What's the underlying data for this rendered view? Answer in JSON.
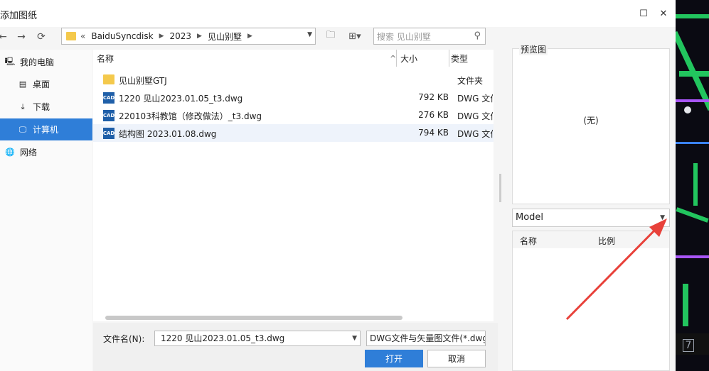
{
  "dialog": {
    "title": "添加图纸",
    "maximize_glyph": "☐",
    "close_glyph": "✕"
  },
  "nav": {
    "breadcrumb": [
      "BaiduSyncdisk",
      "2023",
      "见山别墅"
    ],
    "overflow": "«",
    "search_placeholder": "搜索 见山别墅"
  },
  "sidebar": {
    "items": [
      {
        "label": "我的电脑",
        "icon": "computer-icon"
      },
      {
        "label": "桌面",
        "icon": "desktop-icon"
      },
      {
        "label": "下载",
        "icon": "download-icon"
      },
      {
        "label": "计算机",
        "icon": "monitor-icon"
      },
      {
        "label": "网络",
        "icon": "globe-icon"
      }
    ]
  },
  "columns": {
    "name": "名称",
    "size": "大小",
    "type": "类型"
  },
  "files": [
    {
      "name": "见山别墅GTJ",
      "size": "",
      "type": "文件夹",
      "kind": "folder"
    },
    {
      "name": "1220 见山2023.01.05_t3.dwg",
      "size": "792 KB",
      "type": "DWG 文件",
      "kind": "cad"
    },
    {
      "name": "220103科教馆（修改做法）_t3.dwg",
      "size": "276 KB",
      "type": "DWG 文件",
      "kind": "cad"
    },
    {
      "name": "结构图 2023.01.08.dwg",
      "size": "794 KB",
      "type": "DWG 文件",
      "kind": "cad"
    }
  ],
  "cad_badge": "CAD",
  "bottom": {
    "filename_label": "文件名(N):",
    "filename_value": "1220 见山2023.01.05_t3.dwg",
    "filetype_value": "DWG文件与矢量图文件(*.dwg",
    "open_label": "打开",
    "cancel_label": "取消"
  },
  "preview": {
    "label": "预览图",
    "empty_text": "(无)",
    "layout_select": "Model",
    "col_name": "名称",
    "col_scale": "比例"
  },
  "background": {
    "page_number": "7"
  },
  "colors": {
    "accent": "#2f7ed8",
    "annotation_arrow": "#e8413a",
    "cad_green": "#22c55e"
  }
}
